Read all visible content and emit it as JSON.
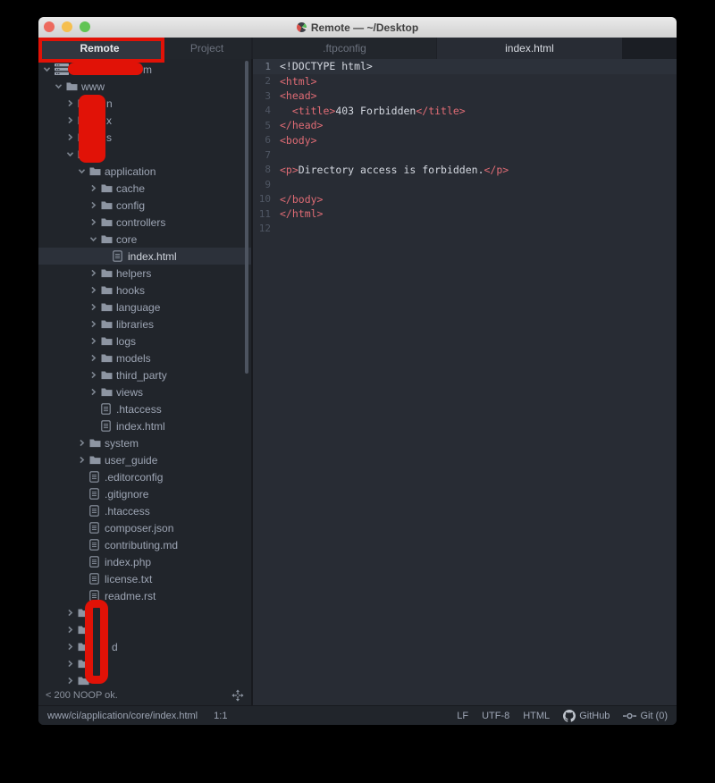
{
  "window": {
    "title": "Remote — ~/Desktop"
  },
  "traffic_lights": [
    "close",
    "minimize",
    "zoom"
  ],
  "dock_tabs": [
    {
      "label": "Remote",
      "active": true,
      "annotated": true
    },
    {
      "label": "Project",
      "active": false
    }
  ],
  "editor_tabs": [
    {
      "label": ".ftpconfig",
      "active": false
    },
    {
      "label": "index.html",
      "active": true
    }
  ],
  "tree": {
    "rows": [
      {
        "type": "server",
        "level": 0,
        "expanded": true,
        "label": "",
        "redacted": "pill",
        "fragment": "m"
      },
      {
        "type": "folder",
        "level": 1,
        "expanded": true,
        "label": "www"
      },
      {
        "type": "folder",
        "level": 2,
        "expanded": false,
        "label": "",
        "redacted": "mid",
        "fragment": "n"
      },
      {
        "type": "folder",
        "level": 2,
        "expanded": false,
        "label": "",
        "redacted": "mid",
        "fragment": "x"
      },
      {
        "type": "folder",
        "level": 2,
        "expanded": false,
        "label": "",
        "redacted": "mid",
        "fragment": "s"
      },
      {
        "type": "folder",
        "level": 2,
        "expanded": true,
        "label": "",
        "redacted": "mid",
        "fragment": ""
      },
      {
        "type": "folder",
        "level": 3,
        "expanded": true,
        "label": "application"
      },
      {
        "type": "folder",
        "level": 4,
        "expanded": false,
        "label": "cache"
      },
      {
        "type": "folder",
        "level": 4,
        "expanded": false,
        "label": "config"
      },
      {
        "type": "folder",
        "level": 4,
        "expanded": false,
        "label": "controllers"
      },
      {
        "type": "folder",
        "level": 4,
        "expanded": true,
        "label": "core"
      },
      {
        "type": "file",
        "level": 5,
        "label": "index.html",
        "selected": true
      },
      {
        "type": "folder",
        "level": 4,
        "expanded": false,
        "label": "helpers"
      },
      {
        "type": "folder",
        "level": 4,
        "expanded": false,
        "label": "hooks"
      },
      {
        "type": "folder",
        "level": 4,
        "expanded": false,
        "label": "language"
      },
      {
        "type": "folder",
        "level": 4,
        "expanded": false,
        "label": "libraries"
      },
      {
        "type": "folder",
        "level": 4,
        "expanded": false,
        "label": "logs"
      },
      {
        "type": "folder",
        "level": 4,
        "expanded": false,
        "label": "models"
      },
      {
        "type": "folder",
        "level": 4,
        "expanded": false,
        "label": "third_party"
      },
      {
        "type": "folder",
        "level": 4,
        "expanded": false,
        "label": "views"
      },
      {
        "type": "file",
        "level": 4,
        "label": ".htaccess"
      },
      {
        "type": "file",
        "level": 4,
        "label": "index.html"
      },
      {
        "type": "folder",
        "level": 3,
        "expanded": false,
        "label": "system"
      },
      {
        "type": "folder",
        "level": 3,
        "expanded": false,
        "label": "user_guide"
      },
      {
        "type": "file",
        "level": 3,
        "label": ".editorconfig"
      },
      {
        "type": "file",
        "level": 3,
        "label": ".gitignore"
      },
      {
        "type": "file",
        "level": 3,
        "label": ".htaccess"
      },
      {
        "type": "file",
        "level": 3,
        "label": "composer.json"
      },
      {
        "type": "file",
        "level": 3,
        "label": "contributing.md"
      },
      {
        "type": "file",
        "level": 3,
        "label": "index.php"
      },
      {
        "type": "file",
        "level": 3,
        "label": "license.txt"
      },
      {
        "type": "file",
        "level": 3,
        "label": "readme.rst"
      },
      {
        "type": "folder",
        "level": 2,
        "expanded": false,
        "label": "",
        "redacted": "bottom",
        "fragment": ""
      },
      {
        "type": "folder",
        "level": 2,
        "expanded": false,
        "label": "",
        "redacted": "bottom",
        "fragment": ""
      },
      {
        "type": "folder",
        "level": 2,
        "expanded": false,
        "label": "",
        "redacted": "bottom",
        "fragment": "d"
      },
      {
        "type": "folder",
        "level": 2,
        "expanded": false,
        "label": "",
        "redacted": "bottom",
        "fragment": ""
      },
      {
        "type": "folder",
        "level": 2,
        "expanded": false,
        "label": "",
        "redacted": "bottom",
        "fragment": ""
      }
    ],
    "ftp_status": "< 200 NOOP ok."
  },
  "editor": {
    "lines": [
      {
        "n": "1",
        "active": true,
        "segs": [
          {
            "c": "plain",
            "t": "<!DOCTYPE html>"
          }
        ]
      },
      {
        "n": "2",
        "segs": [
          {
            "c": "tag",
            "t": "<html>"
          }
        ]
      },
      {
        "n": "3",
        "segs": [
          {
            "c": "tag",
            "t": "<head>"
          }
        ]
      },
      {
        "n": "4",
        "segs": [
          {
            "c": "plain",
            "t": "  "
          },
          {
            "c": "tag",
            "t": "<title>"
          },
          {
            "c": "plain",
            "t": "403 Forbidden"
          },
          {
            "c": "tag",
            "t": "</title>"
          }
        ]
      },
      {
        "n": "5",
        "segs": [
          {
            "c": "tag",
            "t": "</head>"
          }
        ]
      },
      {
        "n": "6",
        "segs": [
          {
            "c": "tag",
            "t": "<body>"
          }
        ]
      },
      {
        "n": "7",
        "segs": []
      },
      {
        "n": "8",
        "segs": [
          {
            "c": "tag",
            "t": "<p>"
          },
          {
            "c": "plain",
            "t": "Directory access is forbidden."
          },
          {
            "c": "tag",
            "t": "</p>"
          }
        ]
      },
      {
        "n": "9",
        "segs": []
      },
      {
        "n": "10",
        "segs": [
          {
            "c": "tag",
            "t": "</body>"
          }
        ]
      },
      {
        "n": "11",
        "segs": [
          {
            "c": "tag",
            "t": "</html>"
          }
        ]
      },
      {
        "n": "12",
        "segs": []
      }
    ]
  },
  "status_bar": {
    "path": "www/ci/application/core/index.html",
    "cursor": "1:1",
    "eol": "LF",
    "encoding": "UTF-8",
    "grammar": "HTML",
    "github": "GitHub",
    "git": "Git (0)"
  },
  "colors": {
    "annotation_red": "#e11207",
    "syntax_tag": "#e06c75",
    "syntax_plain": "#d4d8e0",
    "tree_bg": "#21252b",
    "editor_bg": "#282c34",
    "selection_bg": "#2c313a"
  }
}
